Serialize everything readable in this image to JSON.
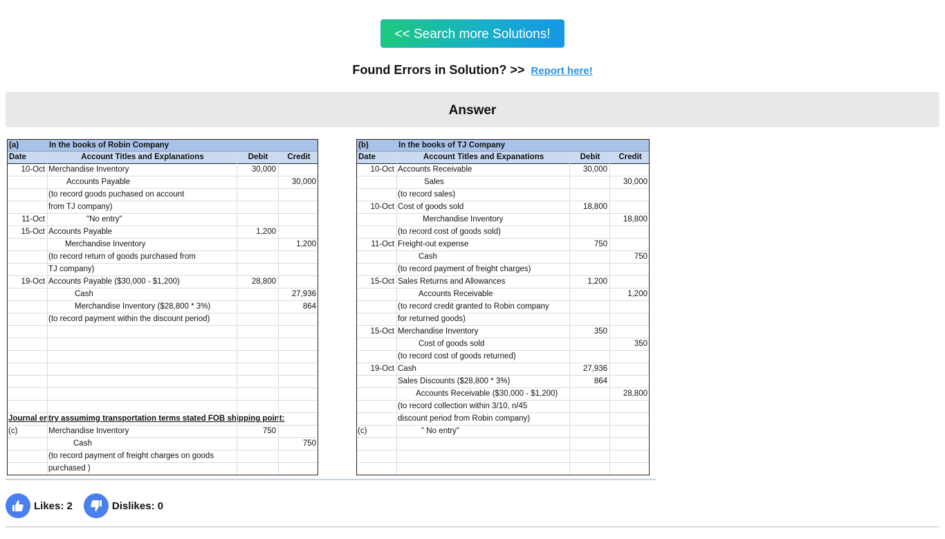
{
  "search_button": "<< Search more Solutions!",
  "errors": {
    "text": "Found Errors in Solution? >>",
    "link": "Report here!"
  },
  "answer_heading": "Answer",
  "sheet_a": {
    "tag": "(a)",
    "title": "In the books of Robin Company",
    "headers": [
      "Date",
      "Account Titles and Explanations",
      "Debit",
      "Credit"
    ],
    "rows": [
      [
        "10-Oct",
        "Merchandise Inventory",
        "30,000",
        ""
      ],
      [
        "",
        "Accounts Payable",
        "",
        "30,000"
      ],
      [
        "",
        "(to record goods puchased on account",
        "",
        ""
      ],
      [
        "",
        "from TJ company)",
        "",
        ""
      ],
      [
        "11-Oct",
        "\"No entry\"",
        "",
        ""
      ],
      [
        "15-Oct",
        "Accounts Payable",
        "1,200",
        ""
      ],
      [
        "",
        "Merchandise Inventory",
        "",
        "1,200"
      ],
      [
        "",
        "(to record return of goods purchased from",
        "",
        ""
      ],
      [
        "",
        "TJ company)",
        "",
        ""
      ],
      [
        "19-Oct",
        "Accounts Payable ($30,000 - $1,200)",
        "28,800",
        ""
      ],
      [
        "",
        "Cash",
        "",
        "27,936"
      ],
      [
        "",
        "Merchandise Inventory ($28,800 * 3%)",
        "",
        "864"
      ],
      [
        "",
        "(to record payment within the discount period)",
        "",
        ""
      ],
      [
        "",
        "",
        "",
        ""
      ],
      [
        "",
        "",
        "",
        ""
      ],
      [
        "",
        "",
        "",
        ""
      ],
      [
        "",
        "",
        "",
        ""
      ],
      [
        "",
        "",
        "",
        ""
      ],
      [
        "",
        "",
        "",
        ""
      ],
      [
        "",
        "",
        "",
        ""
      ],
      [
        "Journal entry assumimg transportation terms stated FOB shipping point:",
        "",
        "",
        ""
      ],
      [
        "(c)",
        "Merchandise Inventory",
        "750",
        ""
      ],
      [
        "",
        "Cash",
        "",
        "750"
      ],
      [
        "",
        "(to record payment of freight charges on goods",
        "",
        ""
      ],
      [
        "",
        "purchased )",
        "",
        ""
      ]
    ]
  },
  "sheet_b": {
    "tag": "(b)",
    "title": "In the books of TJ Company",
    "headers": [
      "Date",
      "Account Titles and Expanations",
      "Debit",
      "Credit"
    ],
    "rows": [
      [
        "10-Oct",
        "Accounts Receivable",
        "30,000",
        ""
      ],
      [
        "",
        "Sales",
        "",
        "30,000"
      ],
      [
        "",
        "(to record sales)",
        "",
        ""
      ],
      [
        "10-Oct",
        "Cost of goods sold",
        "18,800",
        ""
      ],
      [
        "",
        "Merchandise Inventory",
        "",
        "18,800"
      ],
      [
        "",
        "(to record cost of goods sold)",
        "",
        ""
      ],
      [
        "11-Oct",
        "Freight-out expense",
        "750",
        ""
      ],
      [
        "",
        "Cash",
        "",
        "750"
      ],
      [
        "",
        "(to record payment of freight charges)",
        "",
        ""
      ],
      [
        "15-Oct",
        "Sales Returns and Allowances",
        "1,200",
        ""
      ],
      [
        "",
        "Accounts Receivable",
        "",
        "1,200"
      ],
      [
        "",
        "(to record credit granted to Robin company",
        "",
        ""
      ],
      [
        "",
        "for returned goods)",
        "",
        ""
      ],
      [
        "15-Oct",
        "Merchandise Inventory",
        "350",
        ""
      ],
      [
        "",
        "Cost of goods sold",
        "",
        "350"
      ],
      [
        "",
        "(to record cost of goods returned)",
        "",
        ""
      ],
      [
        "19-Oct",
        "Cash",
        "27,936",
        ""
      ],
      [
        "",
        "Sales Discounts ($28,800 * 3%)",
        "864",
        ""
      ],
      [
        "",
        "Accounts Receivable ($30,000 - $1,200)",
        "",
        "28,800"
      ],
      [
        "",
        "(to record collection within 3/10, n/45",
        "",
        ""
      ],
      [
        "",
        "discount period from Robin company)",
        "",
        ""
      ],
      [
        "(c)",
        "\" No entry\"",
        "",
        ""
      ],
      [
        "",
        "",
        "",
        ""
      ],
      [
        "",
        "",
        "",
        ""
      ],
      [
        "",
        "",
        "",
        ""
      ]
    ]
  },
  "likes_label": "Likes: 2",
  "dislikes_label": "Dislikes: 0",
  "icons": {
    "like": "thumbs-up-icon",
    "dislike": "thumbs-down-icon"
  },
  "colors": {
    "header_dark": "#a9c3e8",
    "header_light": "#c9daf1",
    "link": "#2b8fe0",
    "vote_icon": "#4a7ff0"
  }
}
